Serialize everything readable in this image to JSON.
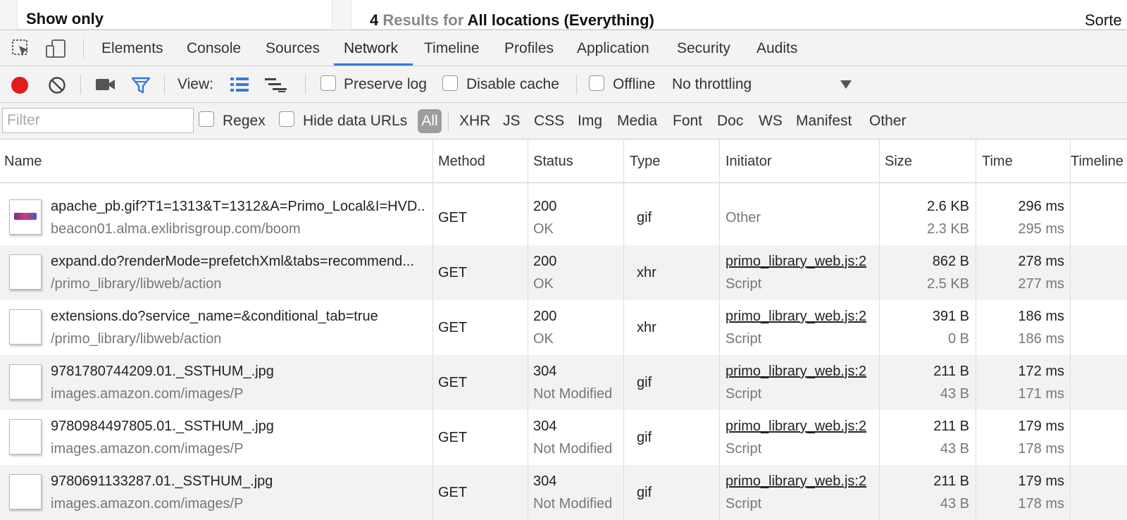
{
  "page": {
    "show_only": "Show only",
    "results_count": "4",
    "results_label": "Results",
    "results_for": "for",
    "results_scope": "All locations (Everything)",
    "sorted": "Sorte"
  },
  "devtools": {
    "tabs": [
      {
        "label": "Elements"
      },
      {
        "label": "Console"
      },
      {
        "label": "Sources"
      },
      {
        "label": "Network",
        "active": true
      },
      {
        "label": "Timeline"
      },
      {
        "label": "Profiles"
      },
      {
        "label": "Application"
      },
      {
        "label": "Security"
      },
      {
        "label": "Audits"
      }
    ],
    "toolbar": {
      "view_label": "View:",
      "preserve_log": "Preserve log",
      "disable_cache": "Disable cache",
      "offline": "Offline",
      "throttling": "No throttling",
      "record_color": "#e31b1b",
      "filter_icon_color": "#3879d9"
    },
    "filterbar": {
      "placeholder": "Filter",
      "regex": "Regex",
      "hide_data_urls": "Hide data URLs",
      "types": [
        "All",
        "XHR",
        "JS",
        "CSS",
        "Img",
        "Media",
        "Font",
        "Doc",
        "WS",
        "Manifest",
        "Other"
      ]
    },
    "columns": [
      "Name",
      "Method",
      "Status",
      "Type",
      "Initiator",
      "Size",
      "Time",
      "Timeline"
    ],
    "rows": [
      {
        "name": "apache_pb.gif?T1=1313&T=1312&A=Primo_Local&I=HVD...",
        "path": "beacon01.alma.exlibrisgroup.com/boom",
        "method": "GET",
        "status": "200",
        "status_text": "OK",
        "type": "gif",
        "initiator": "Other",
        "initiator_sub": "",
        "size": "2.6 KB",
        "size_sub": "2.3 KB",
        "time": "296 ms",
        "time_sub": "295 ms",
        "has_logo": true
      },
      {
        "name": "expand.do?renderMode=prefetchXml&tabs=recommend...",
        "path": "/primo_library/libweb/action",
        "method": "GET",
        "status": "200",
        "status_text": "OK",
        "type": "xhr",
        "initiator": "primo_library_web.js:2",
        "initiator_sub": "Script",
        "size": "862 B",
        "size_sub": "2.5 KB",
        "time": "278 ms",
        "time_sub": "277 ms"
      },
      {
        "name": "extensions.do?service_name=&conditional_tab=true",
        "path": "/primo_library/libweb/action",
        "method": "GET",
        "status": "200",
        "status_text": "OK",
        "type": "xhr",
        "initiator": "primo_library_web.js:2",
        "initiator_sub": "Script",
        "size": "391 B",
        "size_sub": "0 B",
        "time": "186 ms",
        "time_sub": "186 ms"
      },
      {
        "name": "9781780744209.01._SSTHUM_.jpg",
        "path": "images.amazon.com/images/P",
        "method": "GET",
        "status": "304",
        "status_text": "Not Modified",
        "type": "gif",
        "initiator": "primo_library_web.js:2",
        "initiator_sub": "Script",
        "size": "211 B",
        "size_sub": "43 B",
        "time": "172 ms",
        "time_sub": "171 ms"
      },
      {
        "name": "9780984497805.01._SSTHUM_.jpg",
        "path": "images.amazon.com/images/P",
        "method": "GET",
        "status": "304",
        "status_text": "Not Modified",
        "type": "gif",
        "initiator": "primo_library_web.js:2",
        "initiator_sub": "Script",
        "size": "211 B",
        "size_sub": "43 B",
        "time": "179 ms",
        "time_sub": "178 ms"
      },
      {
        "name": "9780691133287.01._SSTHUM_.jpg",
        "path": "images.amazon.com/images/P",
        "method": "GET",
        "status": "304",
        "status_text": "Not Modified",
        "type": "gif",
        "initiator": "primo_library_web.js:2",
        "initiator_sub": "Script",
        "size": "211 B",
        "size_sub": "43 B",
        "time": "179 ms",
        "time_sub": "178 ms"
      }
    ]
  }
}
